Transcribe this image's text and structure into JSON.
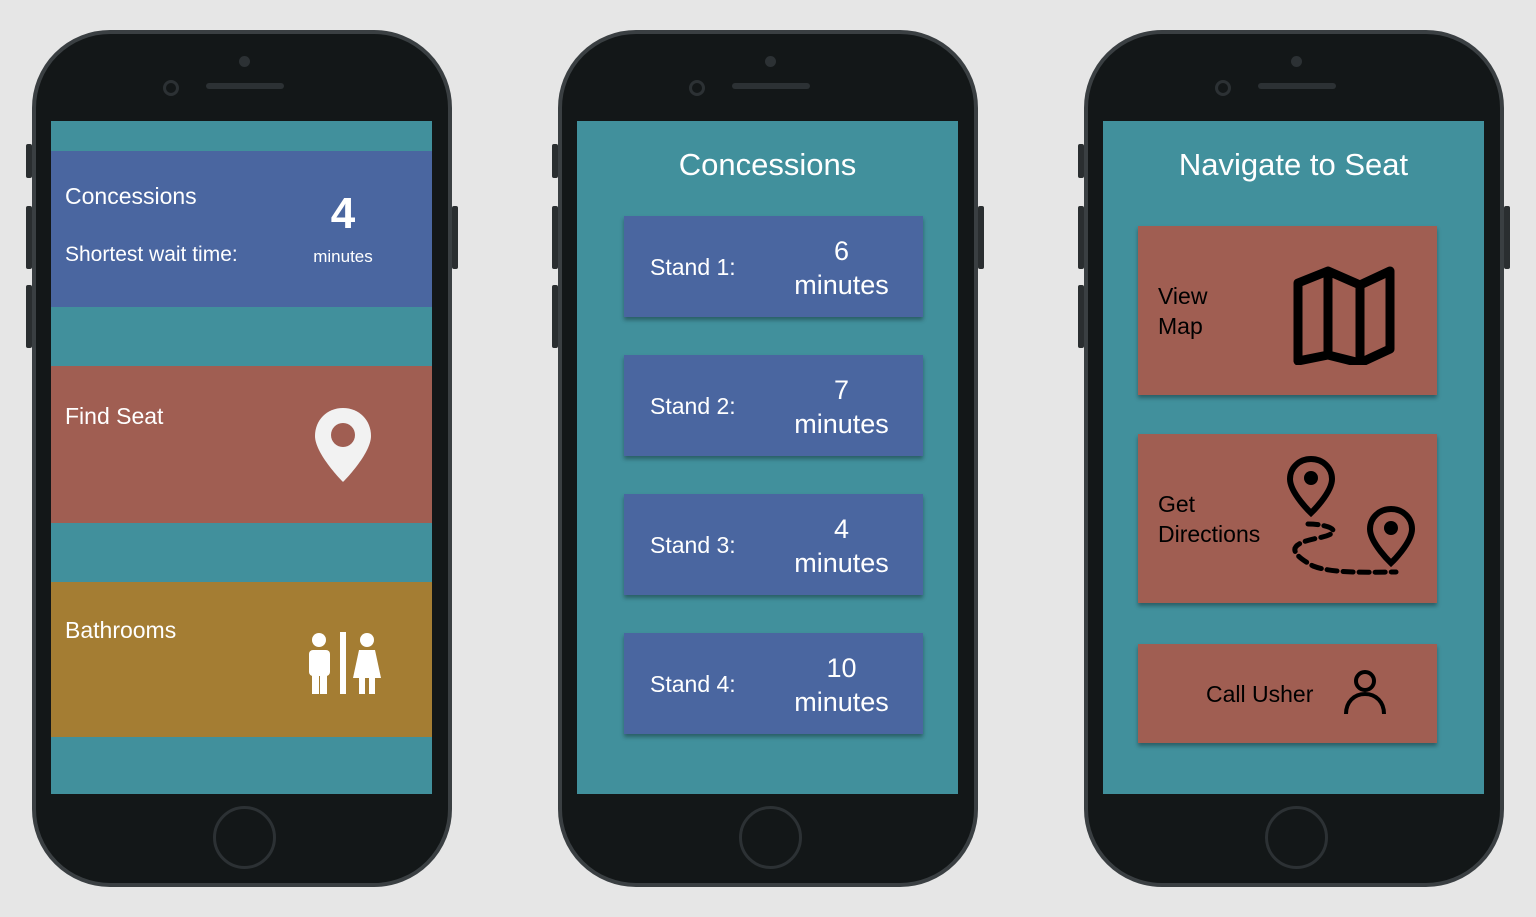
{
  "home": {
    "concessions": {
      "title": "Concessions",
      "subtitle": "Shortest wait time:",
      "value": "4",
      "unit": "minutes"
    },
    "find_seat": {
      "title": "Find Seat",
      "icon": "map-pin-icon"
    },
    "bathrooms": {
      "title": "Bathrooms",
      "icon": "restroom-icon"
    }
  },
  "concessions": {
    "title": "Concessions",
    "stands": [
      {
        "label": "Stand 1:",
        "value": "6",
        "unit": "minutes"
      },
      {
        "label": "Stand 2:",
        "value": "7",
        "unit": "minutes"
      },
      {
        "label": "Stand 3:",
        "value": "4",
        "unit": "minutes"
      },
      {
        "label": "Stand 4:",
        "value": "10",
        "unit": "minutes"
      }
    ]
  },
  "navigate": {
    "title": "Navigate to Seat",
    "view_map": {
      "line1": "View",
      "line2": "Map",
      "icon": "map-icon"
    },
    "directions": {
      "line1": "Get",
      "line2": "Directions",
      "icon": "route-icon"
    },
    "call_usher": {
      "label": "Call Usher",
      "icon": "user-icon"
    }
  },
  "colors": {
    "teal": "#41909c",
    "blue": "#4a66a0",
    "red": "#a05e52",
    "gold": "#a47d33"
  }
}
